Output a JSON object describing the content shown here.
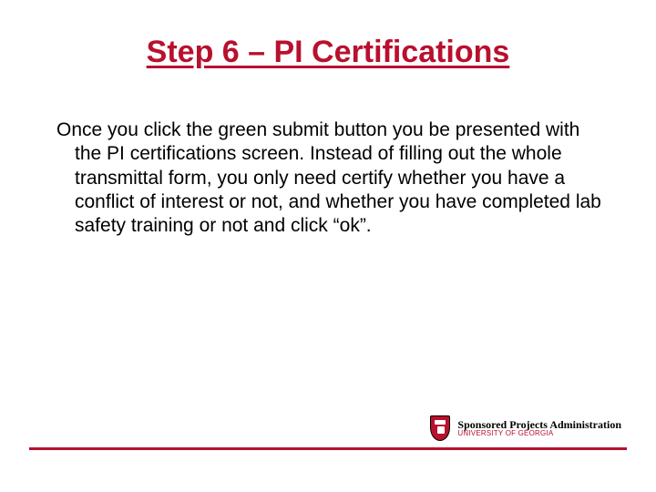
{
  "title": "Step 6 – PI Certifications",
  "body": "Once you click the green submit button you be presented with the PI certifications screen. Instead of filling out the whole transmittal form, you only need certify whether you have a conflict of interest or not, and whether you have completed lab safety training or not and click “ok”.",
  "footer": {
    "logo_line1": "Sponsored Projects Administration",
    "logo_line2": "UNIVERSITY OF GEORGIA"
  },
  "colors": {
    "accent": "#b8102e"
  }
}
